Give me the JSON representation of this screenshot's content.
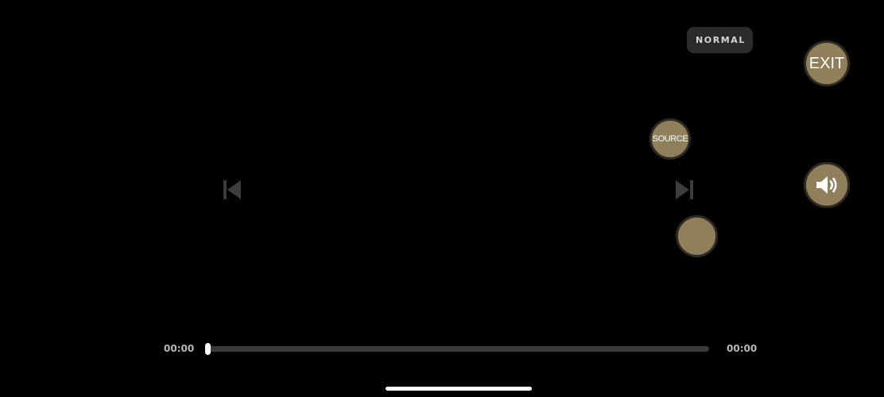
{
  "player": {
    "mode_label": "NORMAL",
    "exit_label": "EXIT",
    "source_label": "SOURCE",
    "volume_icon": "speaker-volume-icon",
    "previous_icon": "skip-previous-icon",
    "next_icon": "skip-next-icon",
    "current_time": "00:00",
    "total_time": "00:00",
    "progress": 0,
    "colors": {
      "button_fill": "#8f7f5b",
      "button_border": "#2f2b24",
      "background": "#000000",
      "track": "#3a3a3c",
      "thumb": "#ffffff",
      "nav_icon": "#3d3d3d"
    }
  }
}
